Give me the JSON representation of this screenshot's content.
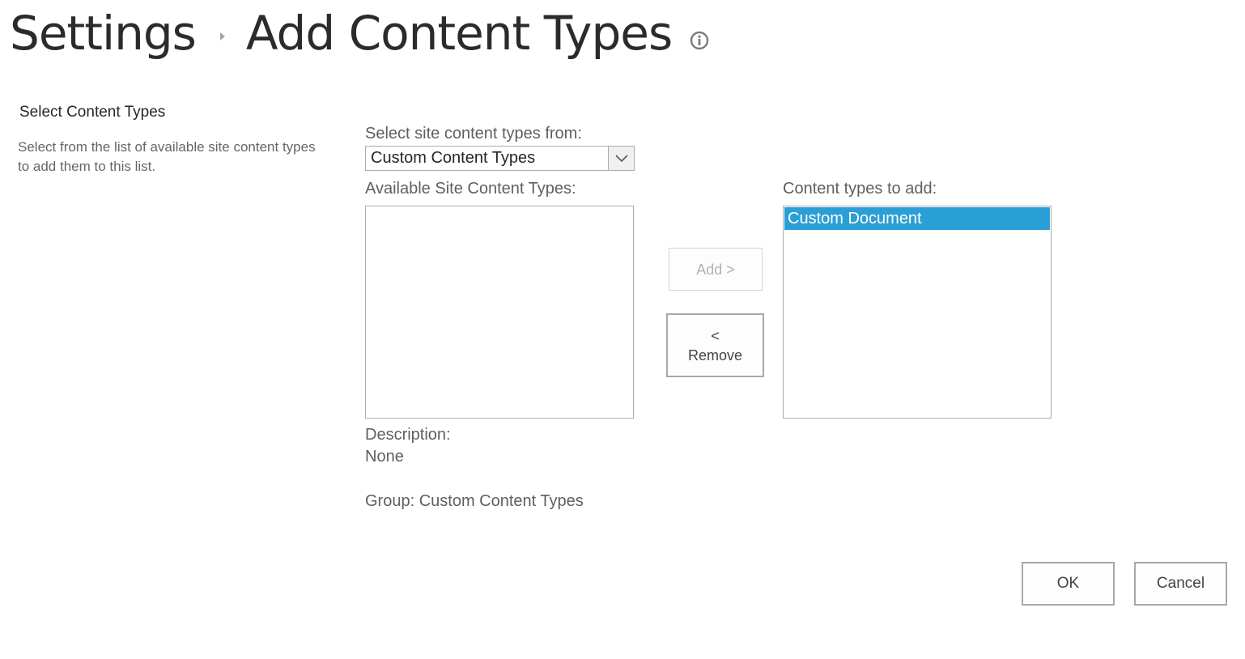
{
  "header": {
    "breadcrumb_root": "Settings",
    "page_title": "Add Content Types",
    "info_icon": "info-circle-icon"
  },
  "section": {
    "title": "Select Content Types",
    "description": "Select from the list of available site content types to add them to this list."
  },
  "source": {
    "label": "Select site content types from:",
    "selected_value": "Custom Content Types"
  },
  "available": {
    "label": "Available Site Content Types:",
    "items": []
  },
  "to_add": {
    "label": "Content types to add:",
    "items": [
      {
        "label": "Custom Document",
        "selected": true
      }
    ]
  },
  "actions": {
    "add_label": "Add >",
    "remove_arrow": "<",
    "remove_label": "Remove"
  },
  "details": {
    "description_label": "Description:",
    "description_value": "None",
    "group_text": "Group: Custom Content Types"
  },
  "footer": {
    "ok_label": "OK",
    "cancel_label": "Cancel"
  },
  "colors": {
    "selection": "#2a9fd6",
    "border": "#ababab"
  }
}
